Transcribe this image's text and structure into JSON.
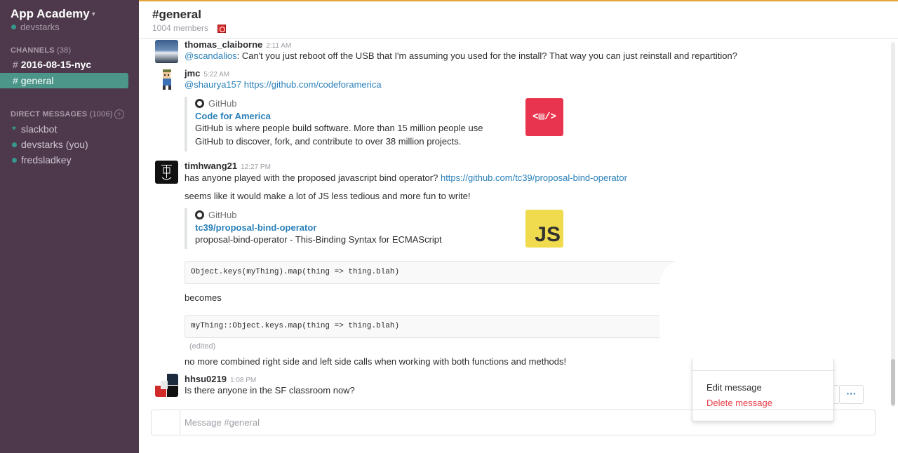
{
  "sidebar": {
    "team_name": "App Academy",
    "username": "devstarks",
    "channels_header": "CHANNELS",
    "channels_count": "(38)",
    "channels": [
      {
        "name": "2016-08-15-nyc"
      },
      {
        "name": "general"
      }
    ],
    "dm_header": "DIRECT MESSAGES",
    "dm_count": "(1006)",
    "dms": [
      {
        "name": "slackbot"
      },
      {
        "name": "devstarks (you)"
      },
      {
        "name": "fredsladkey"
      }
    ]
  },
  "header": {
    "channel_title": "#general",
    "members": "1004 members"
  },
  "messages": [
    {
      "sender": "thomas_claiborne",
      "time": "2:11 AM",
      "mention": "@scandalios",
      "text": ": Can't you just reboot off the USB that I'm assuming you used for the install? That way you can just reinstall and repartition?"
    },
    {
      "sender": "jmc",
      "time": "5:22 AM",
      "mention": "@shaurya157",
      "link": "https://github.com/codeforamerica",
      "attachment": {
        "service": "GitHub",
        "title": "Code for America",
        "line1": "GitHub is where people build software. More than 15 million people use",
        "line2": "GitHub to discover, fork, and contribute to over 38 million projects.",
        "thumb_text": "<▤/>"
      }
    },
    {
      "sender": "timhwang21",
      "time": "12:27 PM",
      "text": "has anyone played with the proposed javascript bind operator? ",
      "link": "https://github.com/tc39/proposal-bind-operator",
      "text2": "seems like it would make a lot of JS less tedious and more fun to write!",
      "attachment": {
        "service": "GitHub",
        "title": "tc39/proposal-bind-operator",
        "line1": "proposal-bind-operator - This-Binding Syntax for ECMAScript",
        "thumb_text": "JS"
      },
      "code1": "Object.keys(myThing).map(thing => thing.blah)",
      "becomes": "becomes",
      "code2": "myThing::Object.keys.map(thing => thing.blah)",
      "edited": "(edited)",
      "text3": "no more combined right side and left side calls when working with both functions and methods!"
    },
    {
      "sender": "hhsu0219",
      "time": "1:08 PM",
      "text": "Is there anyone in the SF classroom now?"
    }
  ],
  "composer": {
    "placeholder": "Message #general"
  },
  "menu": {
    "edit": "Edit message",
    "delete": "Delete message"
  },
  "actions": {
    "more": "···"
  },
  "colors": {
    "sidebar": "#4d394b",
    "active": "#4c9689",
    "link": "#2a80b9",
    "danger": "#e8404a"
  }
}
